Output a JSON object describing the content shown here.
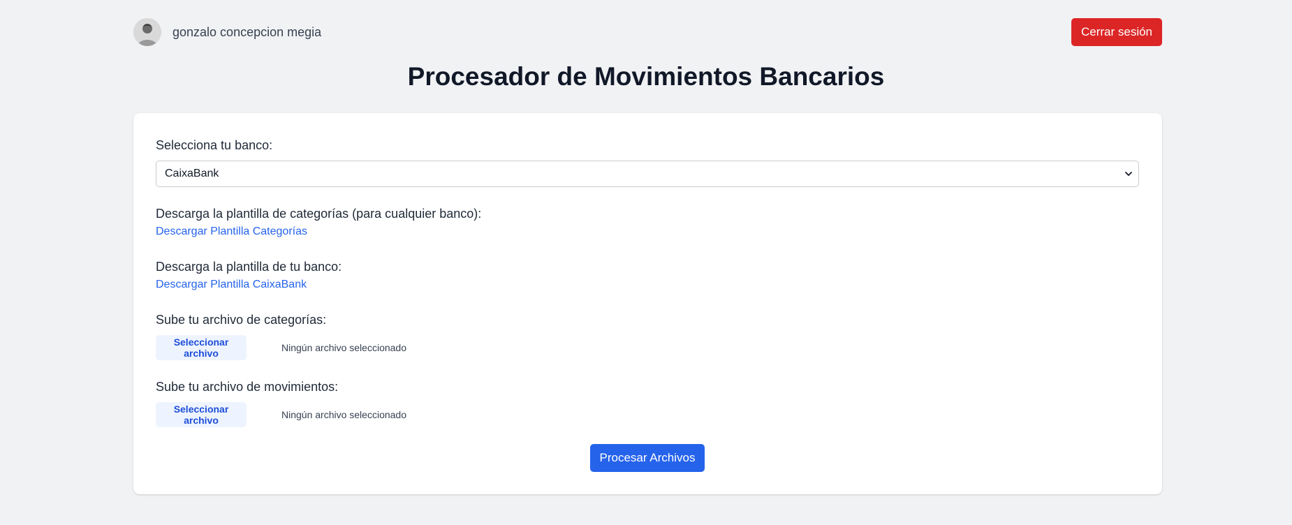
{
  "header": {
    "user_name": "gonzalo concepcion megia",
    "avatar_icon": "user-photo-avatar",
    "logout_label": "Cerrar sesión"
  },
  "page": {
    "title": "Procesador de Movimientos Bancarios"
  },
  "form": {
    "bank_label": "Selecciona tu banco:",
    "bank_selected": "CaixaBank",
    "category_template_label": "Descarga la plantilla de categorías (para cualquier banco):",
    "category_template_link": "Descargar Plantilla Categorías",
    "bank_template_label": "Descarga la plantilla de tu banco:",
    "bank_template_link": "Descargar Plantilla CaixaBank",
    "categories_upload_label": "Sube tu archivo de categorías:",
    "categories_file_button": "Seleccionar archivo",
    "categories_file_status": "Ningún archivo seleccionado",
    "movements_upload_label": "Sube tu archivo de movimientos:",
    "movements_file_button": "Seleccionar archivo",
    "movements_file_status": "Ningún archivo seleccionado",
    "process_button": "Procesar Archivos"
  },
  "colors": {
    "background": "#f1f2f4",
    "logout": "#dc2626",
    "primary": "#2563eb",
    "link": "#2563eb",
    "file_button_bg": "#eef4ff"
  }
}
